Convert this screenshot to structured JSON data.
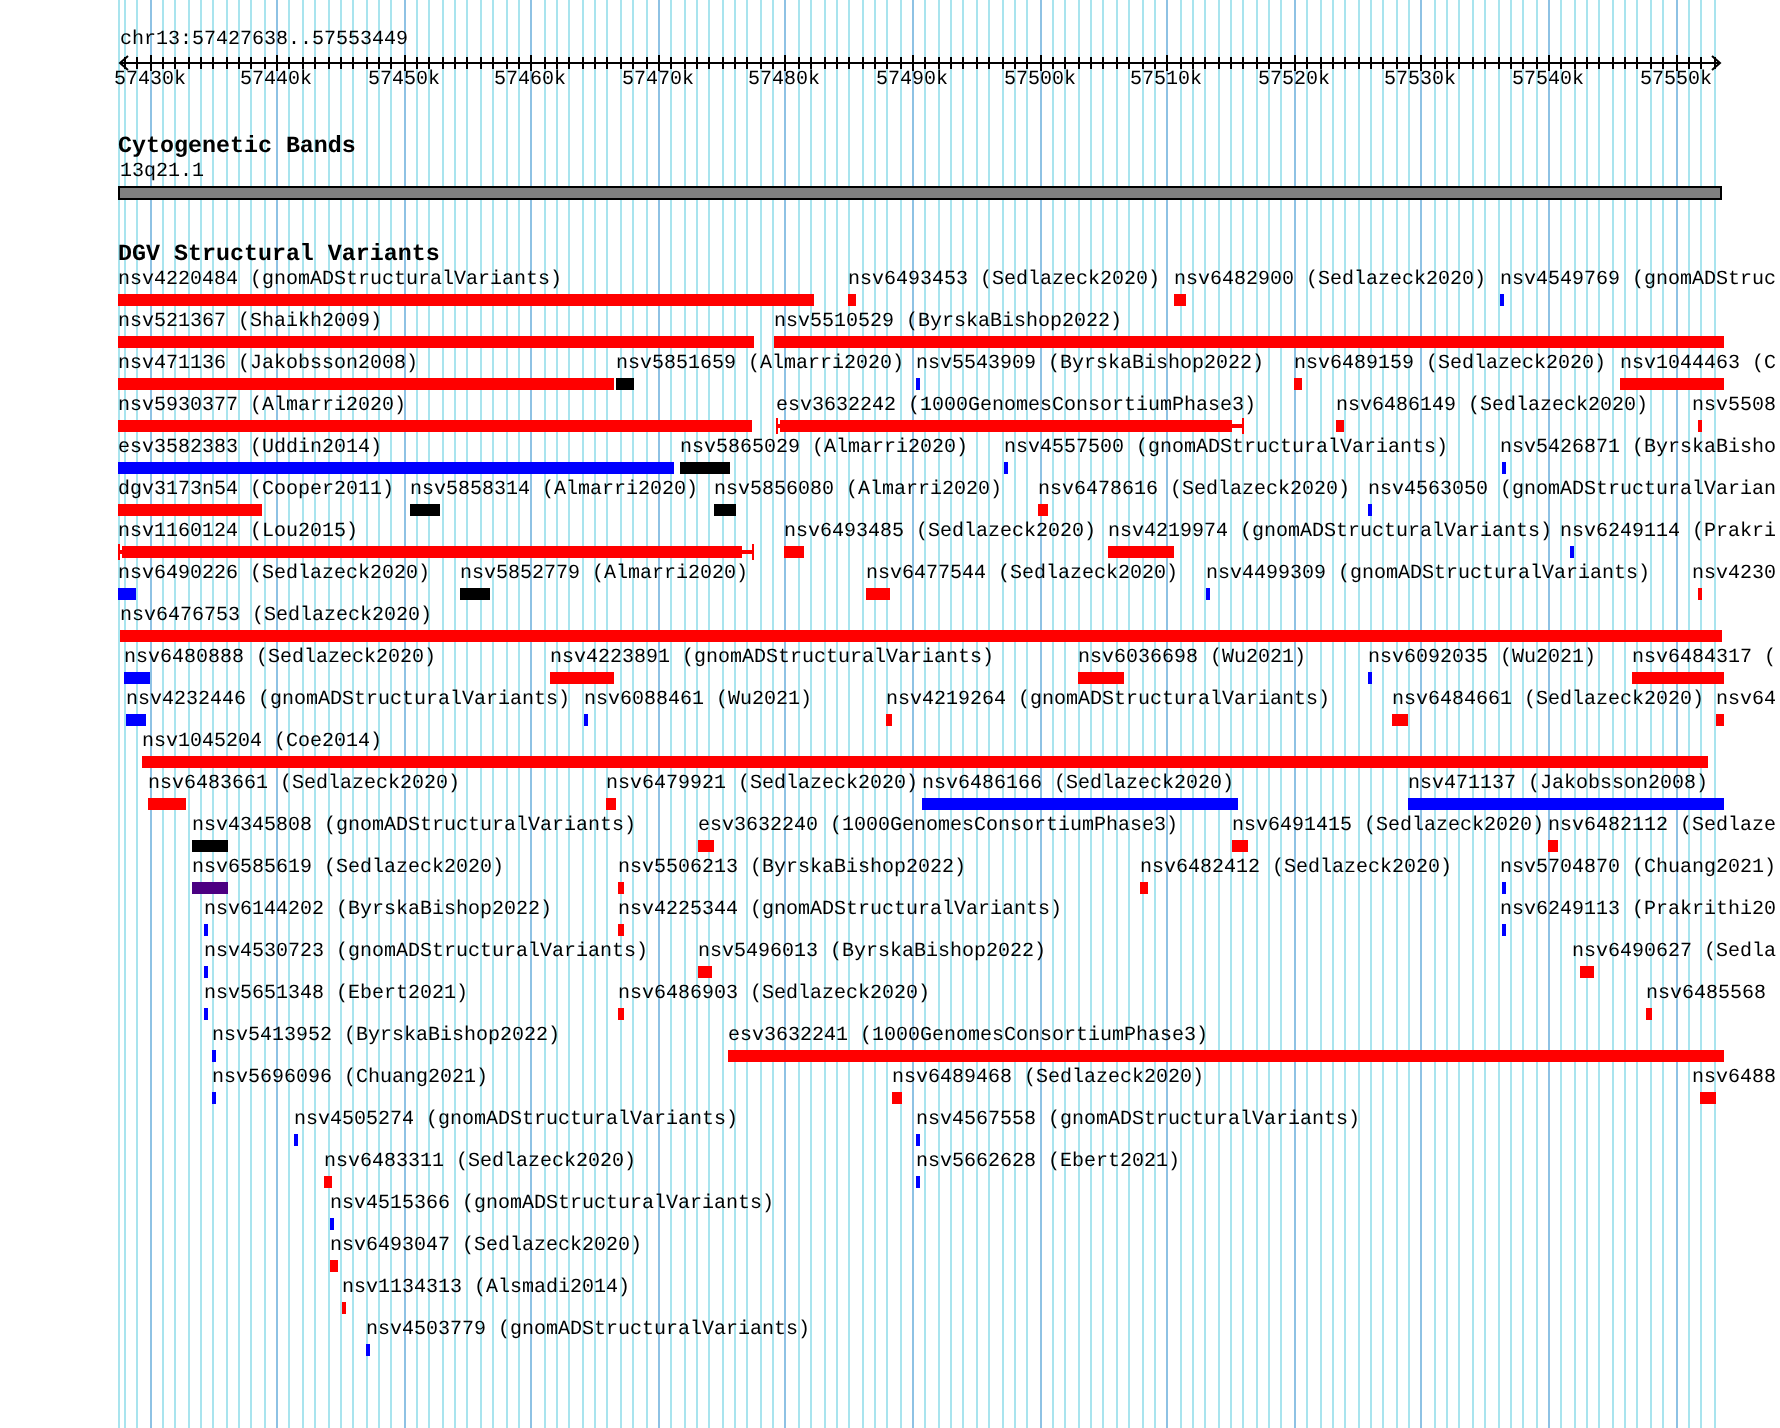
{
  "ruler": {
    "region": "chr13:57427638..57553449",
    "ticks": [
      "57430k",
      "57440k",
      "57450k",
      "57460k",
      "57470k",
      "57480k",
      "57490k",
      "57500k",
      "57510k",
      "57520k",
      "57530k",
      "57540k",
      "57550k"
    ]
  },
  "cytoband_track": {
    "title": "Cytogenetic Bands",
    "band": "13q21.1"
  },
  "variant_track": {
    "title": "DGV Structural Variants",
    "rows": [
      {
        "features": [
          {
            "label": "nsv4220484 (gnomADStructuralVariants)",
            "color": "#ff0000",
            "kind": "bar"
          },
          {
            "label": "nsv6493453 (Sedlazeck2020)",
            "color": "#ff0000",
            "kind": "bar"
          },
          {
            "label": "nsv6482900 (Sedlazeck2020)",
            "color": "#ff0000",
            "kind": "bar"
          },
          {
            "label": "nsv4549769 (gnomADStruc",
            "color": "#0000ff",
            "kind": "bar"
          }
        ]
      },
      {
        "features": [
          {
            "label": "nsv521367 (Shaikh2009)",
            "color": "#ff0000",
            "kind": "bar"
          },
          {
            "label": "nsv5510529 (ByrskaBishop2022)",
            "color": "#ff0000",
            "kind": "bar"
          }
        ]
      },
      {
        "features": [
          {
            "label": "nsv471136 (Jakobsson2008)",
            "color": "#ff0000",
            "kind": "bar"
          },
          {
            "label": "nsv5851659 (Almarri2020)",
            "color": "#000000",
            "kind": "bar"
          },
          {
            "label": "nsv5543909 (ByrskaBishop2022)",
            "color": "#0000ff",
            "kind": "bar"
          },
          {
            "label": "nsv6489159 (Sedlazeck2020)",
            "color": "#ff0000",
            "kind": "bar"
          },
          {
            "label": "nsv1044463 (C",
            "color": "#ff0000",
            "kind": "bar"
          }
        ]
      },
      {
        "features": [
          {
            "label": "nsv5930377 (Almarri2020)",
            "color": "#ff0000",
            "kind": "bar"
          },
          {
            "label": "esv3632242 (1000GenomesConsortiumPhase3)",
            "color": "#ff0000",
            "kind": "capped"
          },
          {
            "label": "nsv6486149 (Sedlazeck2020)",
            "color": "#ff0000",
            "kind": "bar"
          },
          {
            "label": "nsv5508",
            "color": "#ff0000",
            "kind": "bar"
          }
        ]
      },
      {
        "features": [
          {
            "label": "esv3582383 (Uddin2014)",
            "color": "#0000ff",
            "kind": "bar"
          },
          {
            "label": "nsv5865029 (Almarri2020)",
            "color": "#000000",
            "kind": "bar"
          },
          {
            "label": "nsv4557500 (gnomADStructuralVariants)",
            "color": "#0000ff",
            "kind": "bar"
          },
          {
            "label": "nsv5426871 (ByrskaBisho",
            "color": "#0000ff",
            "kind": "bar"
          }
        ]
      },
      {
        "features": [
          {
            "label": "dgv3173n54 (Cooper2011)",
            "color": "#ff0000",
            "kind": "bar"
          },
          {
            "label": "nsv5858314 (Almarri2020)",
            "color": "#000000",
            "kind": "bar"
          },
          {
            "label": "nsv5856080 (Almarri2020)",
            "color": "#000000",
            "kind": "bar"
          },
          {
            "label": "nsv6478616 (Sedlazeck2020)",
            "color": "#ff0000",
            "kind": "bar"
          },
          {
            "label": "nsv4563050 (gnomADStructuralVarian",
            "color": "#0000ff",
            "kind": "bar"
          }
        ]
      },
      {
        "features": [
          {
            "label": "nsv1160124 (Lou2015)",
            "color": "#ff0000",
            "kind": "capped"
          },
          {
            "label": "nsv6493485 (Sedlazeck2020)",
            "color": "#ff0000",
            "kind": "bar"
          },
          {
            "label": "nsv4219974 (gnomADStructuralVariants)",
            "color": "#ff0000",
            "kind": "bar"
          },
          {
            "label": "nsv6249114 (Prakri",
            "color": "#0000ff",
            "kind": "bar"
          }
        ]
      },
      {
        "features": [
          {
            "label": "nsv6490226 (Sedlazeck2020)",
            "color": "#0000ff",
            "kind": "bar"
          },
          {
            "label": "nsv5852779 (Almarri2020)",
            "color": "#000000",
            "kind": "bar"
          },
          {
            "label": "nsv6477544 (Sedlazeck2020)",
            "color": "#ff0000",
            "kind": "bar"
          },
          {
            "label": "nsv4499309 (gnomADStructuralVariants)",
            "color": "#0000ff",
            "kind": "bar"
          },
          {
            "label": "nsv4230",
            "color": "#ff0000",
            "kind": "bar"
          }
        ]
      },
      {
        "features": [
          {
            "label": "nsv6476753 (Sedlazeck2020)",
            "color": "#ff0000",
            "kind": "bar"
          }
        ]
      },
      {
        "features": [
          {
            "label": "nsv6480888 (Sedlazeck2020)",
            "color": "#0000ff",
            "kind": "bar"
          },
          {
            "label": "nsv4223891 (gnomADStructuralVariants)",
            "color": "#ff0000",
            "kind": "bar"
          },
          {
            "label": "nsv6036698 (Wu2021)",
            "color": "#ff0000",
            "kind": "bar"
          },
          {
            "label": "nsv6092035 (Wu2021)",
            "color": "#0000ff",
            "kind": "bar"
          },
          {
            "label": "nsv6484317 (",
            "color": "#ff0000",
            "kind": "bar"
          }
        ]
      },
      {
        "features": [
          {
            "label": "nsv4232446 (gnomADStructuralVariants)",
            "color": "#0000ff",
            "kind": "bar"
          },
          {
            "label": "nsv6088461 (Wu2021)",
            "color": "#0000ff",
            "kind": "bar"
          },
          {
            "label": "nsv4219264 (gnomADStructuralVariants)",
            "color": "#ff0000",
            "kind": "bar"
          },
          {
            "label": "nsv6484661 (Sedlazeck2020)",
            "color": "#ff0000",
            "kind": "bar"
          },
          {
            "label": "nsv64",
            "color": "#ff0000",
            "kind": "bar"
          }
        ]
      },
      {
        "features": [
          {
            "label": "nsv1045204 (Coe2014)",
            "color": "#ff0000",
            "kind": "bar"
          }
        ]
      },
      {
        "features": [
          {
            "label": "nsv6483661 (Sedlazeck2020)",
            "color": "#ff0000",
            "kind": "bar"
          },
          {
            "label": "nsv6479921 (Sedlazeck2020)",
            "color": "#ff0000",
            "kind": "bar"
          },
          {
            "label": "nsv6486166 (Sedlazeck2020)",
            "color": "#0000ff",
            "kind": "bar"
          },
          {
            "label": "nsv471137 (Jakobsson2008)",
            "color": "#0000ff",
            "kind": "bar"
          }
        ]
      },
      {
        "features": [
          {
            "label": "nsv4345808 (gnomADStructuralVariants)",
            "color": "#000000",
            "kind": "bar"
          },
          {
            "label": "esv3632240 (1000GenomesConsortiumPhase3)",
            "color": "#ff0000",
            "kind": "bar"
          },
          {
            "label": "nsv6491415 (Sedlazeck2020)",
            "color": "#ff0000",
            "kind": "bar"
          },
          {
            "label": "nsv6482112 (Sedlaze",
            "color": "#ff0000",
            "kind": "bar"
          }
        ]
      },
      {
        "features": [
          {
            "label": "nsv6585619 (Sedlazeck2020)",
            "color": "#4b0082",
            "kind": "bar"
          },
          {
            "label": "nsv5506213 (ByrskaBishop2022)",
            "color": "#ff0000",
            "kind": "bar"
          },
          {
            "label": "nsv6482412 (Sedlazeck2020)",
            "color": "#ff0000",
            "kind": "bar"
          },
          {
            "label": "nsv5704870 (Chuang2021)",
            "color": "#0000ff",
            "kind": "bar"
          }
        ]
      },
      {
        "features": [
          {
            "label": "nsv6144202 (ByrskaBishop2022)",
            "color": "#0000ff",
            "kind": "bar"
          },
          {
            "label": "nsv4225344 (gnomADStructuralVariants)",
            "color": "#ff0000",
            "kind": "bar"
          },
          {
            "label": "nsv6249113 (Prakrithi20",
            "color": "#0000ff",
            "kind": "bar"
          }
        ]
      },
      {
        "features": [
          {
            "label": "nsv4530723 (gnomADStructuralVariants)",
            "color": "#0000ff",
            "kind": "bar"
          },
          {
            "label": "nsv5496013 (ByrskaBishop2022)",
            "color": "#ff0000",
            "kind": "bar"
          },
          {
            "label": "nsv6490627 (Sedla",
            "color": "#ff0000",
            "kind": "bar"
          }
        ]
      },
      {
        "features": [
          {
            "label": "nsv5651348 (Ebert2021)",
            "color": "#0000ff",
            "kind": "bar"
          },
          {
            "label": "nsv6486903 (Sedlazeck2020)",
            "color": "#ff0000",
            "kind": "bar"
          },
          {
            "label": "nsv6485568",
            "color": "#ff0000",
            "kind": "bar"
          }
        ]
      },
      {
        "features": [
          {
            "label": "nsv5413952 (ByrskaBishop2022)",
            "color": "#0000ff",
            "kind": "bar"
          },
          {
            "label": "esv3632241 (1000GenomesConsortiumPhase3)",
            "color": "#ff0000",
            "kind": "bar"
          }
        ]
      },
      {
        "features": [
          {
            "label": "nsv5696096 (Chuang2021)",
            "color": "#0000ff",
            "kind": "bar"
          },
          {
            "label": "nsv6489468 (Sedlazeck2020)",
            "color": "#ff0000",
            "kind": "bar"
          },
          {
            "label": "nsv6488",
            "color": "#ff0000",
            "kind": "bar"
          }
        ]
      },
      {
        "features": [
          {
            "label": "nsv4505274 (gnomADStructuralVariants)",
            "color": "#0000ff",
            "kind": "bar"
          },
          {
            "label": "nsv4567558 (gnomADStructuralVariants)",
            "color": "#0000ff",
            "kind": "bar"
          }
        ]
      },
      {
        "features": [
          {
            "label": "nsv6483311 (Sedlazeck2020)",
            "color": "#ff0000",
            "kind": "bar"
          },
          {
            "label": "nsv5662628 (Ebert2021)",
            "color": "#0000ff",
            "kind": "bar"
          }
        ]
      },
      {
        "features": [
          {
            "label": "nsv4515366 (gnomADStructuralVariants)",
            "color": "#0000ff",
            "kind": "bar"
          }
        ]
      },
      {
        "features": [
          {
            "label": "nsv6493047 (Sedlazeck2020)",
            "color": "#ff0000",
            "kind": "bar"
          }
        ]
      },
      {
        "features": [
          {
            "label": "nsv1134313 (Alsmadi2014)",
            "color": "#ff0000",
            "kind": "bar"
          }
        ]
      },
      {
        "features": [
          {
            "label": "nsv4503779 (gnomADStructuralVariants)",
            "color": "#0000ff",
            "kind": "bar"
          }
        ]
      }
    ]
  }
}
